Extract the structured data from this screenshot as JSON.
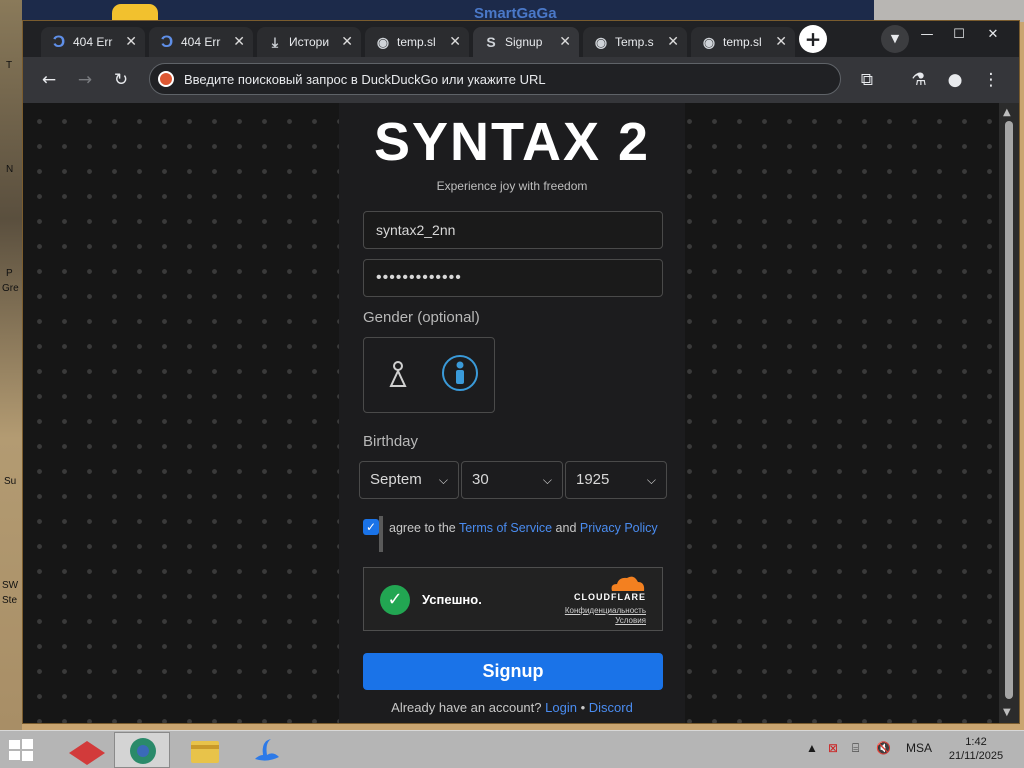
{
  "desktop": {
    "left_labels": [
      "T",
      "N",
      "P",
      "Gre",
      "Su",
      "SW",
      "Ste"
    ],
    "top_ghost_text": "SmartGaGa"
  },
  "browser": {
    "tabs": [
      {
        "title": "404 Err",
        "icon": "c-icon",
        "active": false
      },
      {
        "title": "404 Err",
        "icon": "c-icon",
        "active": false
      },
      {
        "title": "Истори",
        "icon": "download-icon",
        "active": false
      },
      {
        "title": "temp.sl",
        "icon": "globe-icon",
        "active": false
      },
      {
        "title": "Signup",
        "icon": "syntax-icon",
        "active": true
      },
      {
        "title": "Temp.s",
        "icon": "globe-icon",
        "active": false
      },
      {
        "title": "temp.sl",
        "icon": "globe-icon",
        "active": false
      }
    ],
    "new_tab": "+",
    "address_bar": {
      "placeholder": "Введите поисковый запрос в DuckDuckGo или укажите URL",
      "value": ""
    }
  },
  "page": {
    "brand": "SYNTAX 2",
    "tagline": "Experience joy with freedom",
    "username": "syntax2_2nn",
    "password_mask": "•••••••••••••",
    "gender_label": "Gender (optional)",
    "gender_selected": "male",
    "birthday_label": "Birthday",
    "birthday": {
      "month": "Septem",
      "day": "30",
      "year": "1925"
    },
    "agree": {
      "checked": true,
      "prefix": "agree to the",
      "tos": "Terms of Service",
      "and": "and",
      "privacy": "Privacy Policy"
    },
    "captcha": {
      "status": "Успешно.",
      "brand": "CLOUDFLARE",
      "privacy_link": "Конфиденциальность",
      "terms_link": "Условия"
    },
    "signup_button": "Signup",
    "footer": {
      "question": "Already have an account?",
      "login": "Login",
      "separator": "•",
      "discord": "Discord"
    }
  },
  "taskbar": {
    "apps": [
      "redapp-icon",
      "browser-icon",
      "explorer-icon",
      "swan-icon"
    ],
    "language": "MSA",
    "time": "1:42",
    "date": "21/11/2025"
  },
  "colors": {
    "accent": "#1a73e8",
    "link": "#4a8cf0",
    "success": "#22a652",
    "cloudflare_orange": "#f38020",
    "male_icon": "#3a9ad9"
  }
}
